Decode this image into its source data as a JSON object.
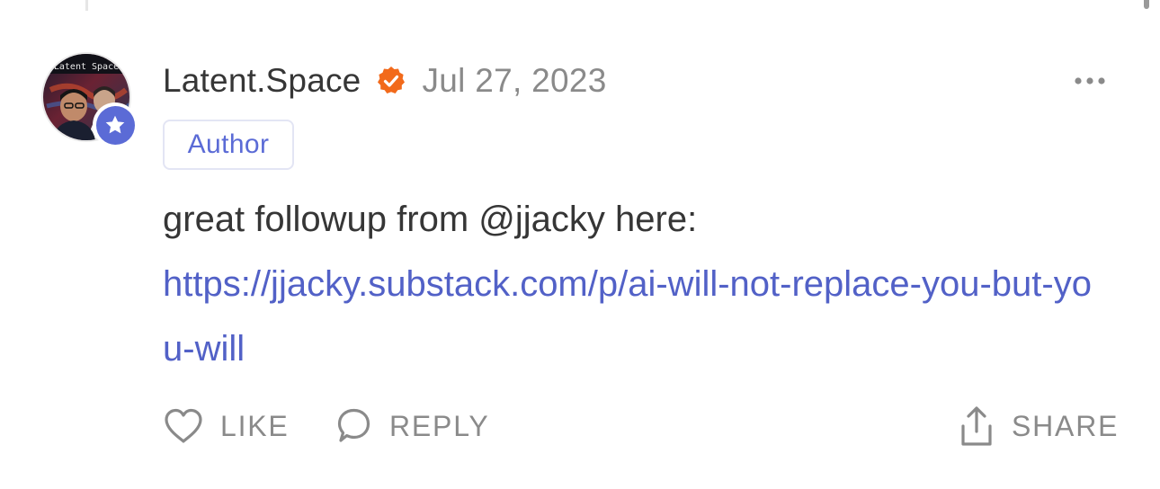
{
  "comment": {
    "avatar_text": "Latent Space",
    "author": "Latent.Space",
    "date": "Jul 27, 2023",
    "role_badge": "Author",
    "text": "great followup from @jjacky here:",
    "link": "https://jjacky.substack.com/p/ai-will-not-replace-you-but-you-will"
  },
  "actions": {
    "like": "LIKE",
    "reply": "REPLY",
    "share": "SHARE"
  },
  "colors": {
    "accent": "#5b6bd6",
    "link": "#5261c7",
    "verified": "#f26a1b",
    "muted": "#8a8a8a",
    "text": "#363636"
  },
  "icons": {
    "avatar_badge": "star-icon",
    "verified": "verified-check-icon",
    "more": "more-dots-icon",
    "like": "heart-icon",
    "reply": "speech-bubble-icon",
    "share": "share-upload-icon"
  }
}
